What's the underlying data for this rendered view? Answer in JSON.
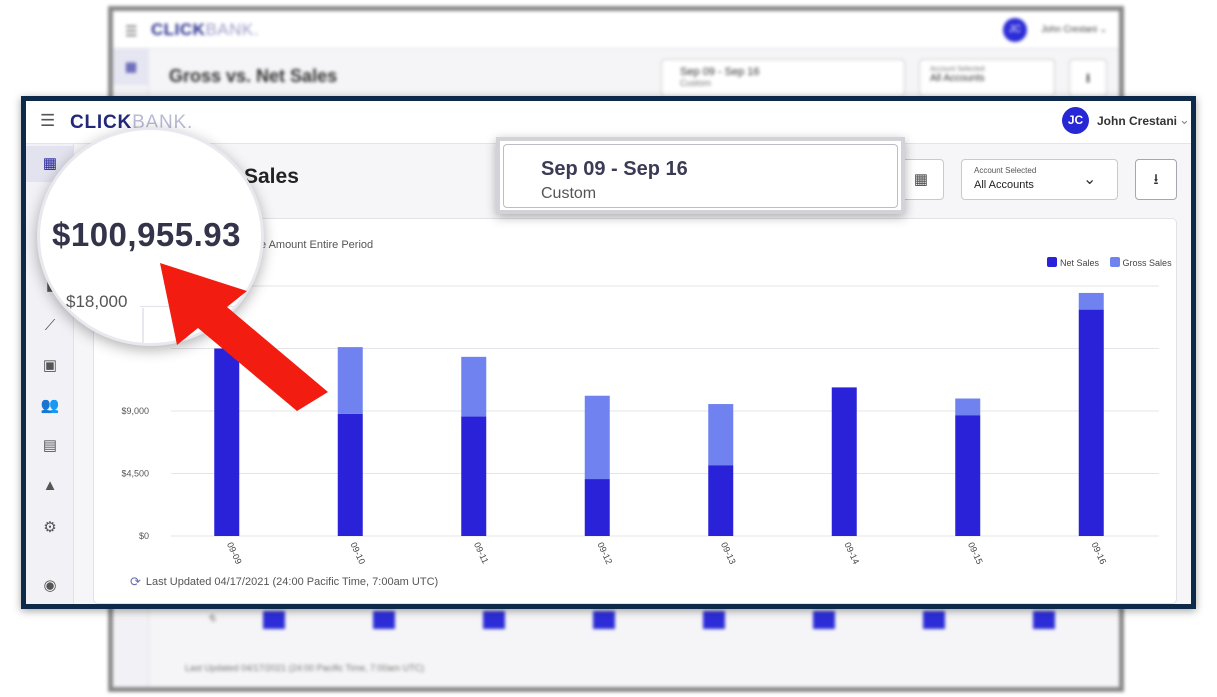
{
  "background": {
    "logo_main": "CLICK",
    "logo_thin": "BANK.",
    "user_initials": "JC",
    "user_name": "John Crestani",
    "page_title": "Gross vs. Net Sales",
    "date_range": "Sep 09 - Sep 16",
    "date_preset": "Custom",
    "account_label": "Account Selected",
    "account_value": "All Accounts",
    "y_zero": "$0",
    "last_updated": "Last Updated 04/17/2021 (24:00 Pacific Time, 7:00am UTC)"
  },
  "header": {
    "logo_main": "CLICK",
    "logo_thin": "BANK.",
    "user_initials": "JC",
    "user_name": "John Crestani"
  },
  "page": {
    "title_fragment": "Sales",
    "period_label": "e Amount Entire Period"
  },
  "controls": {
    "account_label": "Account Selected",
    "account_value": "All Accounts"
  },
  "date_popover": {
    "range": "Sep 09 - Sep 16",
    "preset": "Custom"
  },
  "magnifier": {
    "total": "$100,955.93",
    "axis_label": "$18,000"
  },
  "footer": {
    "last_updated": "Last Updated 04/17/2021 (24:00 Pacific Time, 7:00am UTC)"
  },
  "colors": {
    "net_sales": "#2a22d8",
    "gross_sales": "#6f82ef",
    "frame": "#0e2a4a",
    "arrow": "#f21d10"
  },
  "icons": [
    "menu-icon",
    "grid-icon",
    "bar-chart-icon",
    "trend-icon",
    "clipboard-icon",
    "users-icon",
    "store-icon",
    "graduation-icon",
    "settings-icon",
    "account-icon",
    "calendar-icon",
    "chevron-down-icon",
    "download-icon",
    "refresh-icon"
  ],
  "chart_data": {
    "type": "bar",
    "stacked": true,
    "categories": [
      "09-09",
      "09-10",
      "09-11",
      "09-12",
      "09-13",
      "09-14",
      "09-15",
      "09-16"
    ],
    "series": [
      {
        "name": "Net Sales",
        "values": [
          13500,
          8800,
          8600,
          4100,
          5100,
          10700,
          8700,
          16300
        ]
      },
      {
        "name": "Gross Sales",
        "values": [
          0,
          4800,
          4300,
          6000,
          4400,
          0,
          1200,
          1200
        ]
      }
    ],
    "y_ticks": [
      "$0",
      "$4,500",
      "$9,000"
    ],
    "ylim": [
      0,
      18000
    ],
    "legend": [
      "Net Sales",
      "Gross Sales"
    ],
    "legend_position": "top-right",
    "grid": true
  }
}
